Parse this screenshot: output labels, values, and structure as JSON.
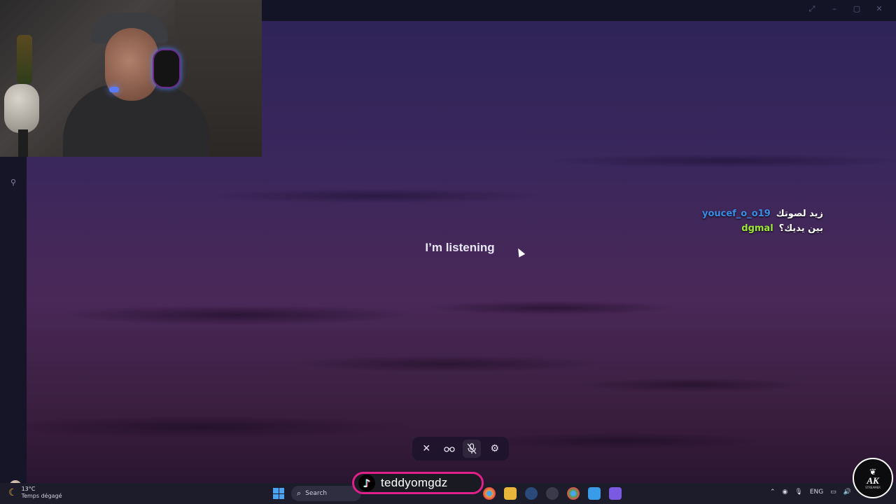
{
  "window": {
    "controls": [
      "⤢",
      "–",
      "▢",
      "✕"
    ]
  },
  "sidebar": {
    "pin_icon": "pin-icon"
  },
  "main": {
    "status_text": "I’m listening"
  },
  "chat": [
    {
      "user": "youcef_o_o19",
      "user_color": "#3a8ee6",
      "message": "زيد لصوتك"
    },
    {
      "user": "dgmal",
      "user_color": "#9ee83a",
      "message": "بين يديك؟"
    }
  ],
  "voice_controls": {
    "close": "✕",
    "glasses": "👓",
    "mute": "🎙",
    "settings": "⚙"
  },
  "taskbar": {
    "weather_temp": "13°C",
    "weather_desc": "Temps dégagé",
    "search_label": "Search",
    "language": "ENG",
    "apps": [
      "#e8a33a",
      "#2f7de0",
      "#6b6fd6",
      "#e24b4b",
      "#4aa4f2",
      "#3a9be8",
      "#7b5ae2"
    ]
  },
  "overlay": {
    "tiktok_handle": "teddyomgdz",
    "emblem_text": "AK",
    "emblem_sub": "STREAMER"
  }
}
